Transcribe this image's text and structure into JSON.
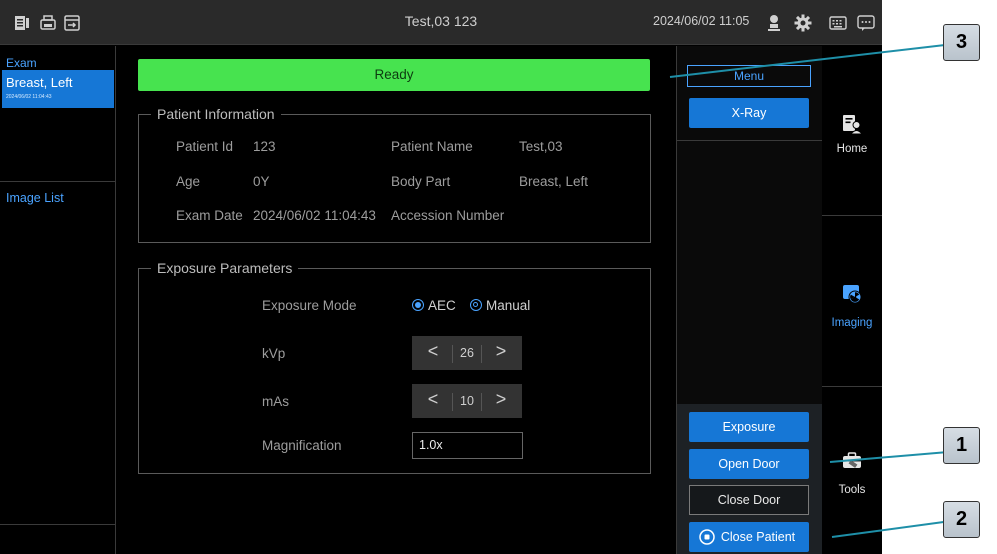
{
  "topbar": {
    "title": "Test,03  123",
    "datetime": "2024/06/02 11:05",
    "icons": [
      "worklist-icon",
      "printer-icon",
      "export-icon",
      "user-icon",
      "gear-icon",
      "keyboard-icon",
      "chat-icon"
    ]
  },
  "left_panel": {
    "exam_label": "Exam",
    "exam_item_name": "Breast, Left",
    "exam_item_date": "2024/06/02 11:04:43",
    "image_list_label": "Image List"
  },
  "status": {
    "text": "Ready",
    "color": "#47e34f"
  },
  "patient_info": {
    "legend": "Patient Information",
    "patient_id_label": "Patient Id",
    "patient_id": "123",
    "patient_name_label": "Patient Name",
    "patient_name": "Test,03",
    "age_label": "Age",
    "age": "0Y",
    "body_part_label": "Body Part",
    "body_part": "Breast, Left",
    "exam_date_label": "Exam Date",
    "exam_date": "2024/06/02 11:04:43",
    "accession_label": "Accession Number",
    "accession": ""
  },
  "exposure": {
    "legend": "Exposure Parameters",
    "mode_label": "Exposure Mode",
    "mode_options": [
      "AEC",
      "Manual"
    ],
    "mode_selected": "AEC",
    "kvp_label": "kVp",
    "kvp_value": "26",
    "mas_label": "mAs",
    "mas_value": "10",
    "dec_symbol": "<",
    "inc_symbol": ">",
    "magnification_label": "Magnification",
    "magnification_value": "1.0x"
  },
  "right_col": {
    "menu_label": "Menu",
    "xray_label": "X-Ray",
    "exposure_label": "Exposure",
    "open_door_label": "Open Door",
    "close_door_label": "Close Door",
    "close_patient_label": "Close Patient"
  },
  "nav": {
    "home_label": "Home",
    "imaging_label": "Imaging",
    "tools_label": "Tools"
  },
  "annotations": {
    "one": "1",
    "two": "2",
    "three": "3"
  },
  "colors": {
    "accent": "#1677d6",
    "link": "#4aa3ff",
    "status_ok": "#47e34f"
  }
}
